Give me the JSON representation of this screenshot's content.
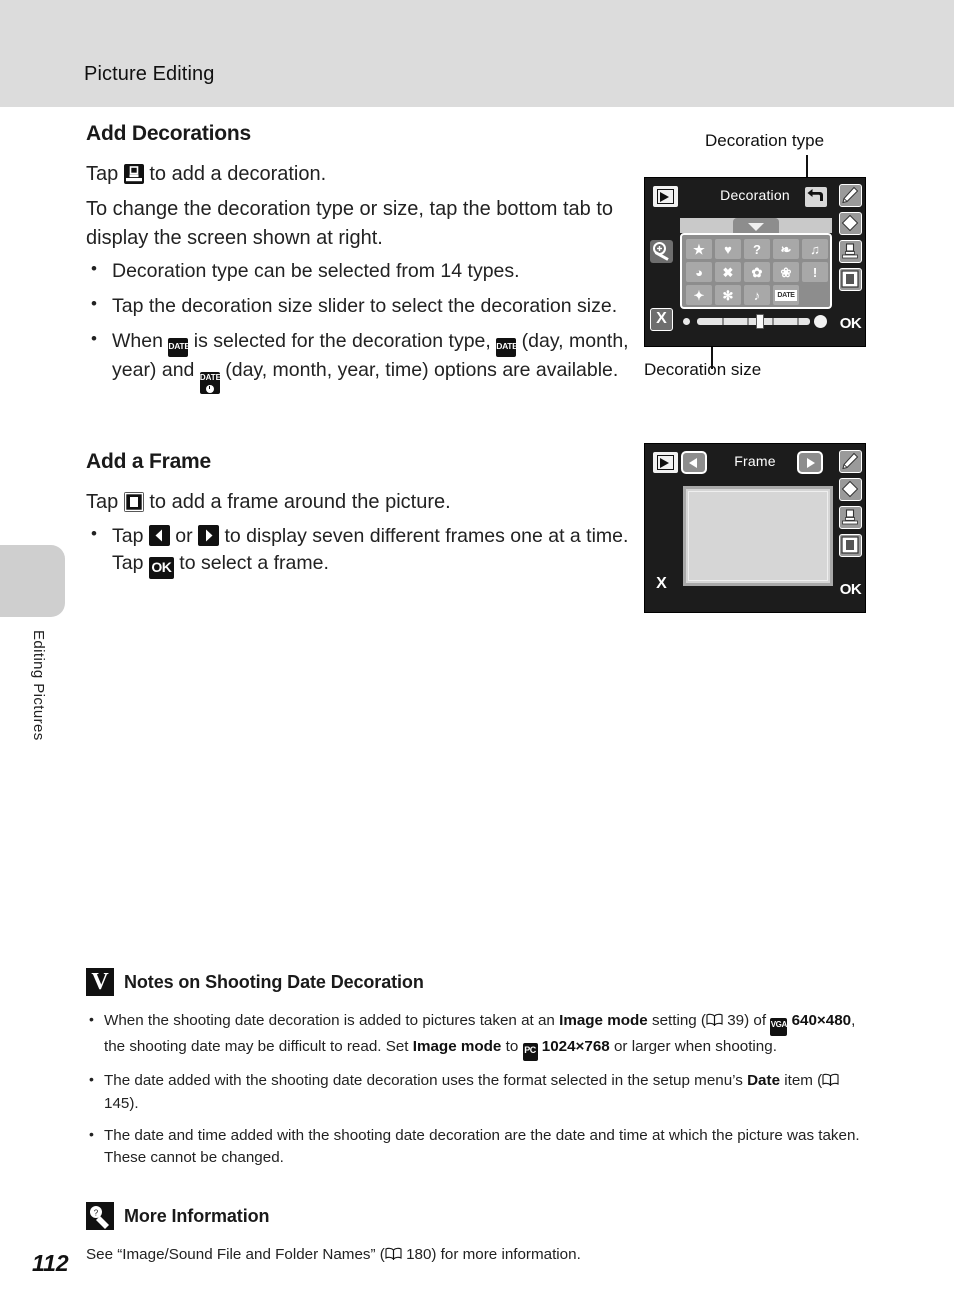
{
  "header": {
    "title": "Picture Editing"
  },
  "sidebar": {
    "tab_label": "Editing Pictures"
  },
  "page": {
    "number": "112"
  },
  "sections": {
    "decorations": {
      "heading": "Add Decorations",
      "line1_pre": "Tap",
      "line1_post": "to add a decoration.",
      "line2": "To change the decoration type or size, tap the bottom tab to display the screen shown at right.",
      "bullets": [
        {
          "text": "Decoration type can be selected from 14 types."
        },
        {
          "text": "Tap the decoration size slider to select the decoration size."
        },
        {
          "pre": "When",
          "mid1": "is selected for the decoration type,",
          "mid2": "(day, month, year) and",
          "post": "(day, month, year, time) options are available."
        }
      ]
    },
    "frame": {
      "heading": "Add a Frame",
      "line1_pre": "Tap",
      "line1_post": "to add a frame around the picture.",
      "bullet": {
        "pre": "Tap",
        "or": "or",
        "mid": "to display seven different frames one at a time. Tap",
        "post": "to select a frame."
      }
    }
  },
  "decoration_screen": {
    "title": "Decoration",
    "callout_type": "Decoration type",
    "callout_size": "Decoration size",
    "play_icon": "playback-icon",
    "undo_icon": "undo-icon",
    "magnifier_icon": "magnifier-icon",
    "cancel_label": "X",
    "ok_label": "OK",
    "rail_icons": [
      "pencil-icon",
      "eraser-icon",
      "stamp-icon",
      "frame-icon"
    ],
    "decoration_types": [
      "star",
      "heart",
      "question",
      "leaf",
      "headphones",
      "drop",
      "butterfly",
      "flower-gear",
      "ribbon",
      "exclamation",
      "sparkle",
      "flower",
      "music-note",
      "DATE"
    ],
    "decoration_glyphs": [
      "★",
      "♥",
      "?",
      "❧",
      "♫",
      "◕",
      "✖",
      "✿",
      "❀",
      "!",
      "✦",
      "✻",
      "♪",
      "DATE"
    ],
    "slider": {
      "position_percent": 60,
      "tick_count": 4
    }
  },
  "frame_screen": {
    "title": "Frame",
    "play_icon": "playback-icon",
    "prev_label": "previous-frame",
    "next_label": "next-frame",
    "cancel_label": "X",
    "ok_label": "OK",
    "rail_icons": [
      "pencil-icon",
      "eraser-icon",
      "stamp-icon",
      "frame-icon"
    ]
  },
  "notes": {
    "caution": {
      "title": "Notes on Shooting Date Decoration",
      "items": [
        {
          "p1": "When the shooting date decoration is added to pictures taken at an",
          "b1": "Image mode",
          "p2": "setting (",
          "ref1": "39",
          "p3": ") of",
          "b2": "640×480",
          "p4": ", the shooting date may be difficult to read. Set",
          "b3": "Image mode",
          "p5": "to",
          "b4": "1024×768",
          "p6": "or larger when shooting."
        },
        {
          "p1": "The date added with the shooting date decoration uses the format selected in the setup menu’s",
          "b1": "Date",
          "p2": "item (",
          "ref1": "145",
          "p3": ")."
        },
        {
          "p1": "The date and time added with the shooting date decoration are the date and time at which the picture was taken. These cannot be changed."
        }
      ]
    },
    "more_info": {
      "title": "More Information",
      "body_pre": "See “Image/Sound File and Folder Names” (",
      "ref": "180",
      "body_post": ") for more information."
    }
  }
}
